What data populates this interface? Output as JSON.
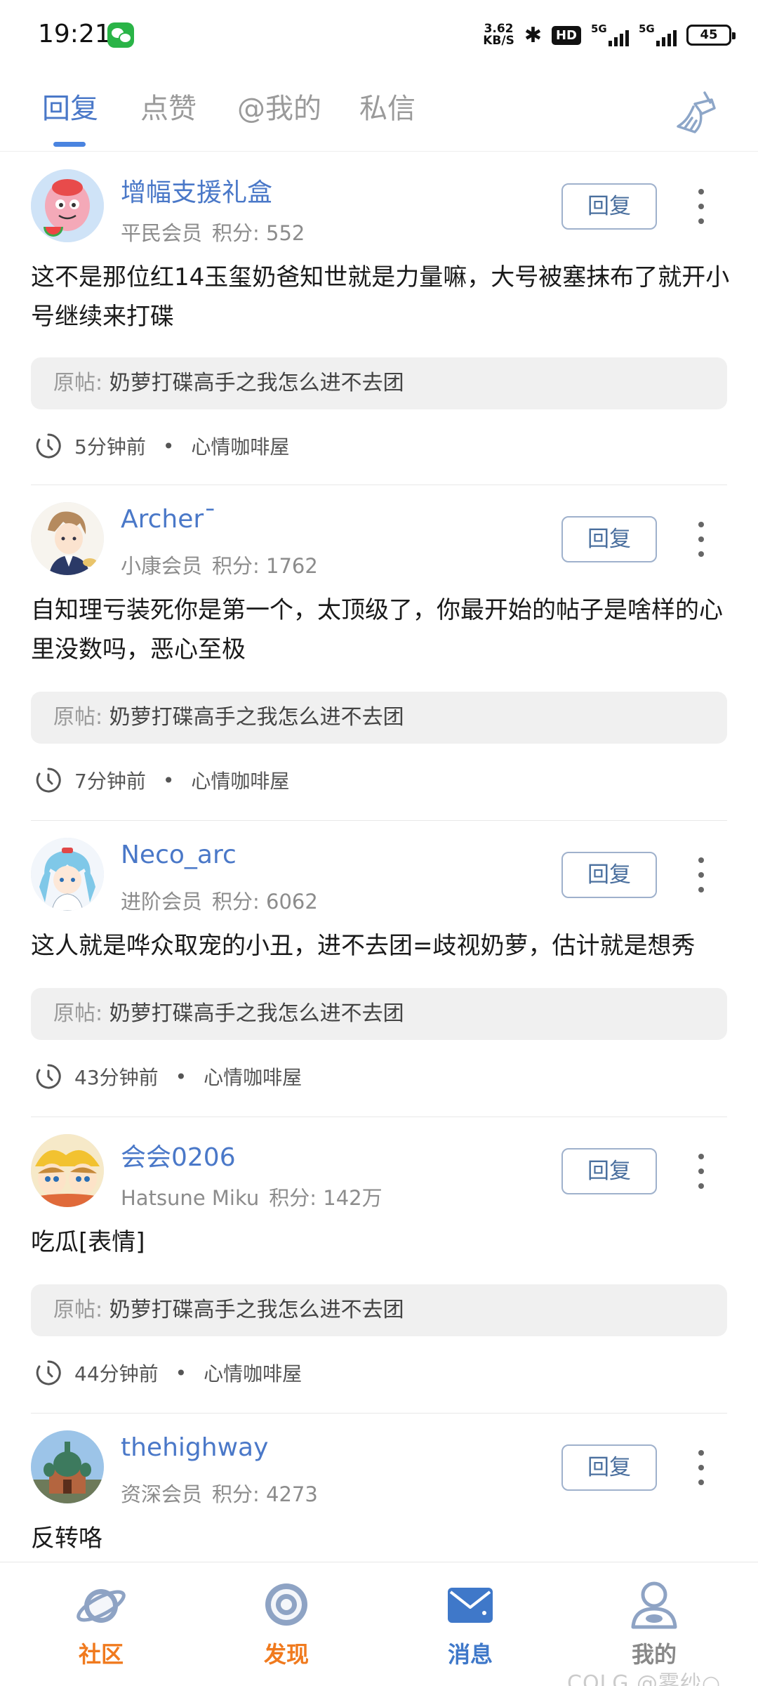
{
  "status_bar": {
    "time": "19:21",
    "net_speed_value": "3.62",
    "net_speed_unit": "KB/S",
    "hd_label": "HD",
    "sim1_tag": "5G",
    "sim2_tag": "5G",
    "battery": "45"
  },
  "tabs": [
    {
      "label": "回复",
      "active": true
    },
    {
      "label": "点赞",
      "active": false
    },
    {
      "label": "@我的",
      "active": false
    },
    {
      "label": "私信",
      "active": false
    }
  ],
  "reply_button_label": "回复",
  "original_prefix": "原帖:",
  "items": [
    {
      "username": "增幅支援礼盒",
      "rank": "平民会员",
      "points": "积分: 552",
      "content": "这不是那位红14玉玺奶爸知世就是力量嘛，大号被塞抹布了就开小号继续来打碟",
      "original_title": "奶萝打碟高手之我怎么进不去团",
      "time": "5分钟前",
      "forum": "心情咖啡屋"
    },
    {
      "username": "Archerˉ",
      "rank": "小康会员",
      "points": "积分: 1762",
      "content": "自知理亏装死你是第一个，太顶级了，你最开始的帖子是啥样的心里没数吗，恶心至极",
      "original_title": "奶萝打碟高手之我怎么进不去团",
      "time": "7分钟前",
      "forum": "心情咖啡屋"
    },
    {
      "username": "Neco_arc",
      "rank": "进阶会员",
      "points": "积分: 6062",
      "content": "这人就是哗众取宠的小丑，进不去团=歧视奶萝，估计就是想秀",
      "original_title": "奶萝打碟高手之我怎么进不去团",
      "time": "43分钟前",
      "forum": "心情咖啡屋"
    },
    {
      "username": "会会0206",
      "rank": "Hatsune Miku",
      "points": "积分: 142万",
      "content": "吃瓜[表情]",
      "original_title": "奶萝打碟高手之我怎么进不去团",
      "time": "44分钟前",
      "forum": "心情咖啡屋"
    },
    {
      "username": "thehighway",
      "rank": "资深会员",
      "points": "积分: 4273",
      "content": "反转咯"
    }
  ],
  "bottom_nav": [
    {
      "label": "社区",
      "icon": "planet-icon",
      "color": "#f07a1e"
    },
    {
      "label": "发现",
      "icon": "target-icon",
      "color": "#f07a1e"
    },
    {
      "label": "消息",
      "icon": "mail-icon",
      "color": "#3f78c9"
    },
    {
      "label": "我的",
      "icon": "user-icon",
      "color": "#888888"
    }
  ],
  "watermark": "COLG @雾纱○",
  "colors": {
    "accent_blue": "#4a78c8",
    "orange": "#f07a1e"
  }
}
